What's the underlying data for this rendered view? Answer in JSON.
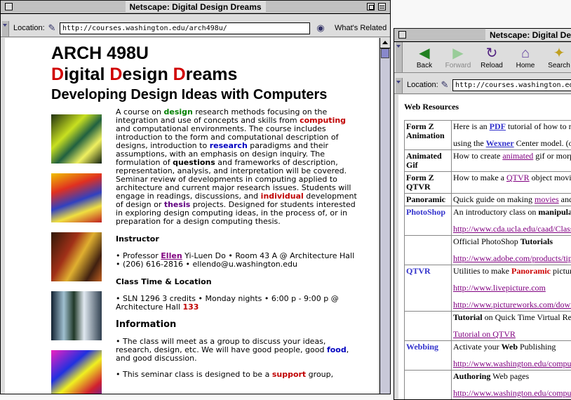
{
  "left_window": {
    "title": "Netscape: Digital Design Dreams",
    "location_label": "Location:",
    "url": "http://courses.washington.edu/arch498u/",
    "whats_related": "What's Related",
    "page": {
      "course_code": "ARCH 498U",
      "title_initials": [
        "D",
        "D",
        "D"
      ],
      "title_rests": [
        "igital ",
        "esign ",
        "reams"
      ],
      "subtitle": "Developing Design Ideas with Computers",
      "description": [
        {
          "t": "A course on "
        },
        {
          "t": "design",
          "c": "g"
        },
        {
          "t": " research methods focusing on the integration and use of concepts and skills from "
        },
        {
          "t": "computing",
          "c": "rd"
        },
        {
          "t": " and computational environments. The course includes introduction to the form and computational description of designs, introduction to "
        },
        {
          "t": "research",
          "c": "b"
        },
        {
          "t": " paradigms and their assumptions, with an emphasis on design inquiry. The formulation of "
        },
        {
          "t": "questions",
          "c": "bo"
        },
        {
          "t": " and frameworks of description, representation, analysis, and interpretation will be covered. Seminar review of developments in computing applied to architecture and current major research issues. Students will engage in readings, discussions, and "
        },
        {
          "t": "individual",
          "c": "rd"
        },
        {
          "t": " development of design or "
        },
        {
          "t": "thesis",
          "c": "pu"
        },
        {
          "t": " projects. Designed for students interested in exploring design computing ideas, in the process of, or in preparation for a design computing thesis."
        }
      ],
      "instructor_heading": "Instructor",
      "instructor": [
        {
          "t": "• Professor "
        },
        {
          "t": "Ellen",
          "c": "lnk"
        },
        {
          "t": " Yi-Luen Do • Room 43 A @ Architecture Hall • (206) 616-2816 • ellendo@u.washington.edu"
        }
      ],
      "class_heading": "Class Time & Location",
      "class_info": [
        {
          "t": "• SLN 1296 3 credits • Monday nights • 6:00 p - 9:00 p @ Architecture Hall "
        },
        {
          "t": "133",
          "c": "rd"
        }
      ],
      "info_heading": "Information",
      "info_1": [
        {
          "t": "• The class will meet as a group to discuss your ideas, research, design, etc. We will have good people, good "
        },
        {
          "t": "food",
          "c": "b"
        },
        {
          "t": ", and good discussion."
        }
      ],
      "info_2": [
        {
          "t": "• This seminar class is designed to be a "
        },
        {
          "t": "support",
          "c": "rd"
        },
        {
          "t": " group,"
        }
      ]
    }
  },
  "right_window": {
    "title": "Netscape: Digital De",
    "toolbar": [
      {
        "label": "Back",
        "icon": "back-arrow-icon",
        "glyph": "◀",
        "enabled": true
      },
      {
        "label": "Forward",
        "icon": "forward-arrow-icon",
        "glyph": "▶",
        "enabled": false
      },
      {
        "label": "Reload",
        "icon": "reload-icon",
        "glyph": "↻",
        "enabled": true
      },
      {
        "label": "Home",
        "icon": "home-icon",
        "glyph": "⌂",
        "enabled": true
      },
      {
        "label": "Search",
        "icon": "search-icon",
        "glyph": "✦",
        "enabled": true
      }
    ],
    "location_label": "Location:",
    "url": "http://courses.washington.edu/arch",
    "heading": "Web Resources",
    "rows": [
      {
        "key": "Form Z Animation",
        "key_style": "k",
        "cell": [
          {
            "t": "Here is an "
          },
          {
            "t": "PDF",
            "c": "ulb"
          },
          {
            "t": " tutorial of how to m"
          }
        ],
        "cell2": [
          {
            "t": "using the "
          },
          {
            "t": "Wexner",
            "c": "ulb"
          },
          {
            "t": " Center model. (or"
          }
        ]
      },
      {
        "key": "Animated Gif",
        "key_style": "k",
        "cell": [
          {
            "t": "How to create "
          },
          {
            "t": "animated",
            "c": "ul"
          },
          {
            "t": " gif or morph"
          }
        ]
      },
      {
        "key": "Form Z QTVR",
        "key_style": "k",
        "cell": [
          {
            "t": "How to make a "
          },
          {
            "t": "QTVR",
            "c": "ul"
          },
          {
            "t": " object movie"
          }
        ]
      },
      {
        "key": "Panoramic",
        "key_style": "k",
        "cell": [
          {
            "t": "Quick guide on making "
          },
          {
            "t": "movies",
            "c": "ul"
          },
          {
            "t": " and"
          }
        ]
      },
      {
        "key": "PhotoShop",
        "key_style": "kp",
        "cell": [
          {
            "t": "An introductory class on "
          },
          {
            "t": "manipula",
            "c": "bo"
          }
        ],
        "cell2": [
          {
            "t": "http://www.cda.ucla.edu/caad/Class",
            "c": "ul"
          }
        ]
      },
      {
        "key": "",
        "key_style": "k",
        "cell": [
          {
            "t": "Official PhotoShop "
          },
          {
            "t": "Tutorials",
            "c": "bo"
          }
        ],
        "cell2": [
          {
            "t": "http://www.adobe.com/products/tips/",
            "c": "ul"
          }
        ]
      },
      {
        "key": "QTVR",
        "key_style": "kp",
        "cell": [
          {
            "t": "Utilities to make "
          },
          {
            "t": "Panoramic",
            "c": "red"
          },
          {
            "t": " picture"
          }
        ],
        "cell2": [
          {
            "t": "http://www.livepicture.com",
            "c": "ul"
          }
        ],
        "cell3": [
          {
            "t": "http://www.pictureworks.com/downl",
            "c": "ul"
          }
        ]
      },
      {
        "key": "",
        "key_style": "k",
        "cell": [
          {
            "t": "Tutorial",
            "c": "bo"
          },
          {
            "t": " on Quick Time Virtual Re"
          }
        ],
        "cell2": [
          {
            "t": "Tutorial on QTVR",
            "c": "ul"
          }
        ]
      },
      {
        "key": "Webbing",
        "key_style": "kp",
        "cell": [
          {
            "t": "Activate your "
          },
          {
            "t": "Web",
            "c": "bo"
          },
          {
            "t": " Publishing"
          }
        ],
        "cell2": [
          {
            "t": "http://www.washington.edu/computi",
            "c": "ul"
          }
        ]
      },
      {
        "key": "",
        "key_style": "k",
        "cell": [
          {
            "t": "Authoring",
            "c": "bo"
          },
          {
            "t": " Web pages"
          }
        ],
        "cell2": [
          {
            "t": "http://www.washington.edu/computi",
            "c": "ul"
          }
        ]
      }
    ]
  },
  "colors": {
    "accent_red": "#d00000",
    "link_purple": "#800080",
    "link_blue": "#3333cc",
    "green": "#008000"
  }
}
